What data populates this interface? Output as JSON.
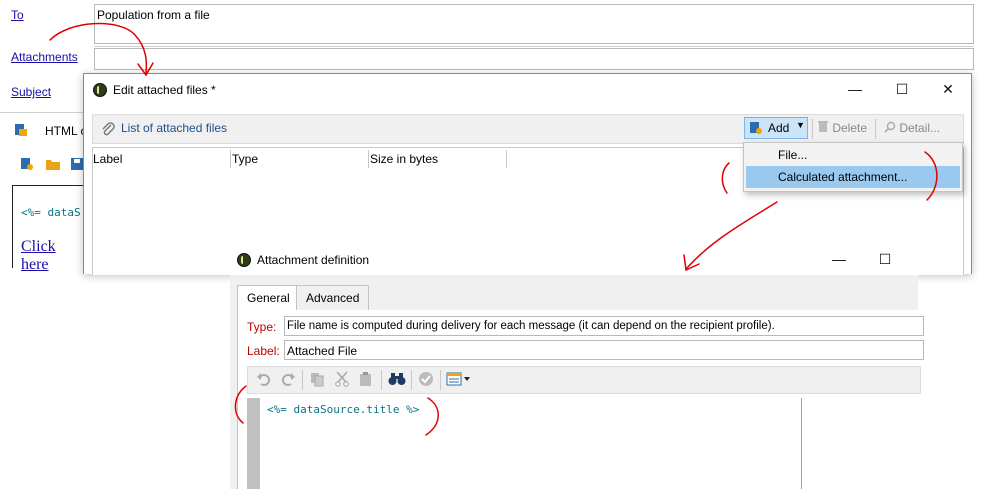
{
  "delivery": {
    "to_link": "To",
    "to_value": "Population from a file",
    "attachments_link": "Attachments",
    "subject_link": "Subject",
    "html_tab_label": "HTML c",
    "code_snippet": "<%= dataS",
    "click_here": "Click here"
  },
  "edit_window": {
    "title": "Edit attached files *",
    "list_label": "List of attached files",
    "add_label": "Add",
    "delete_label": "Delete",
    "detail_label": "Detail...",
    "columns": [
      "Label",
      "Type",
      "Size in bytes"
    ],
    "menu_items": [
      "File...",
      "Calculated attachment..."
    ]
  },
  "attachment_window": {
    "title": "Attachment definition",
    "tabs": [
      "General",
      "Advanced"
    ],
    "type_label": "Type:",
    "type_value": "File name is computed during delivery for each message (it can depend on the recipient profile).",
    "label_label": "Label:",
    "label_value": "Attached File",
    "code": "<%= dataSource.title %>"
  },
  "colors": {
    "annotation": "#e00000",
    "menu_highlight": "#99c9ef",
    "link": "#1a0dab",
    "code": "#0b7285"
  }
}
